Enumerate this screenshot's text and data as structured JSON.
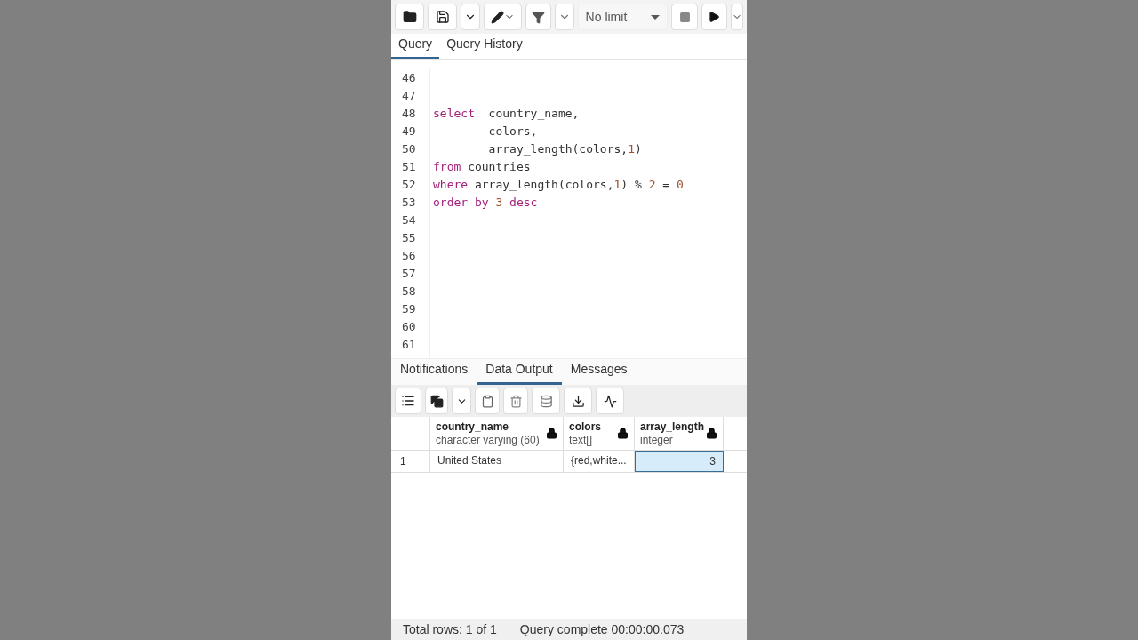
{
  "toolbar": {
    "limit": "No limit"
  },
  "editor_tabs": [
    {
      "label": "Query",
      "selected": true
    },
    {
      "label": "Query History",
      "selected": false
    }
  ],
  "editor_lines": [
    {
      "number": "46"
    },
    {
      "number": "47"
    },
    {
      "number": "48",
      "tokens": [
        {
          "kind": "keyword",
          "text": "select"
        },
        {
          "kind": "plain",
          "text": "  country_name,"
        }
      ]
    },
    {
      "number": "49",
      "tokens": [
        {
          "kind": "plain",
          "text": "        colors,"
        }
      ]
    },
    {
      "number": "50",
      "tokens": [
        {
          "kind": "plain",
          "text": "        array_length(colors,"
        },
        {
          "kind": "number",
          "text": "1"
        },
        {
          "kind": "plain",
          "text": ")"
        }
      ]
    },
    {
      "number": "51",
      "tokens": [
        {
          "kind": "keyword",
          "text": "from"
        },
        {
          "kind": "plain",
          "text": " countries"
        }
      ]
    },
    {
      "number": "52",
      "tokens": [
        {
          "kind": "keyword",
          "text": "where"
        },
        {
          "kind": "plain",
          "text": " array_length(colors,"
        },
        {
          "kind": "number",
          "text": "1"
        },
        {
          "kind": "plain",
          "text": ") % "
        },
        {
          "kind": "number",
          "text": "2"
        },
        {
          "kind": "plain",
          "text": " = "
        },
        {
          "kind": "number",
          "text": "0"
        }
      ]
    },
    {
      "number": "53",
      "tokens": [
        {
          "kind": "keyword",
          "text": "order by"
        },
        {
          "kind": "number",
          "text": " 3"
        },
        {
          "kind": "keyword",
          "text": " desc"
        }
      ]
    },
    {
      "number": "54"
    },
    {
      "number": "55"
    },
    {
      "number": "56"
    },
    {
      "number": "57"
    },
    {
      "number": "58"
    },
    {
      "number": "59"
    },
    {
      "number": "60"
    },
    {
      "number": "61"
    }
  ],
  "output_tabs": [
    {
      "label": "Notifications",
      "selected": false
    },
    {
      "label": "Data Output",
      "selected": true
    },
    {
      "label": "Messages",
      "selected": false
    }
  ],
  "table": {
    "columns": [
      {
        "name": "country_name",
        "type": "character varying (60)"
      },
      {
        "name": "colors",
        "type": "text[]"
      },
      {
        "name": "array_length",
        "type": "integer"
      }
    ],
    "rows": [
      {
        "number": "1",
        "cells": [
          {
            "text": "United States",
            "kind": "text",
            "selected": false
          },
          {
            "text": "{red,white...",
            "kind": "text",
            "selected": false
          },
          {
            "text": "3",
            "kind": "number",
            "selected": true
          }
        ]
      }
    ]
  },
  "status_bar": {
    "rows": "Total rows: 1 of 1",
    "query": "Query complete 00:00:00.073"
  }
}
